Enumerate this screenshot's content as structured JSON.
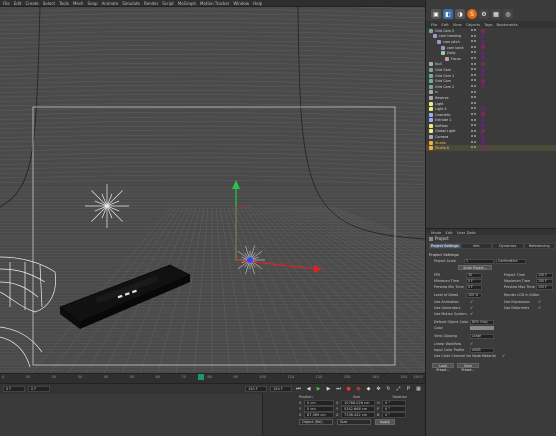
{
  "menubar": [
    "File",
    "Edit",
    "Create",
    "Select",
    "Tools",
    "Mesh",
    "Snap",
    "Animate",
    "Simulate",
    "Render",
    "Script",
    "MoGraph",
    "Motion Tracker",
    "Window",
    "Help"
  ],
  "viewport": {
    "name": "3D Perspective Viewport"
  },
  "timeline": {
    "ticks": [
      "0",
      "10",
      "20",
      "30",
      "40",
      "50",
      "60",
      "70",
      "80",
      "90",
      "100",
      "110",
      "120",
      "130",
      "140",
      "150"
    ],
    "end_frame": "150 F"
  },
  "transport": {
    "start_field": "0 F",
    "current_field": "0 F",
    "end_field": "150 F",
    "end2_field": "150 F"
  },
  "coords": {
    "headers": [
      "Position",
      "Size",
      "Rotation"
    ],
    "rows": [
      {
        "axis": "X",
        "pos": "0 cm",
        "size": "10768.026 cm",
        "rot_axis": "H",
        "rot": "0 °"
      },
      {
        "axis": "Y",
        "pos": "0 cm",
        "size": "5342.668 cm",
        "rot_axis": "P",
        "rot": "0 °"
      },
      {
        "axis": "Z",
        "pos": "87.569 cm",
        "size": "7338.442 cm",
        "rot_axis": "B",
        "rot": "0 °"
      }
    ],
    "mode": "Object (Rel)",
    "size_mode": "Size",
    "apply": "Apply"
  },
  "right_toolbar": {
    "icons": [
      "layout-icon",
      "cube-icon",
      "render-icon",
      "s-logo-icon",
      "gear-icon",
      "grid-icon",
      "target-icon"
    ]
  },
  "object_manager": {
    "menu": [
      "File",
      "Edit",
      "View",
      "Objects",
      "Tags",
      "Bookmarks"
    ],
    "objects": [
      {
        "name": "Grid Cam 2",
        "indent": 0
      },
      {
        "name": "cam heading",
        "indent": 1
      },
      {
        "name": "cam pitch",
        "indent": 2
      },
      {
        "name": "cam bank",
        "indent": 3
      },
      {
        "name": "Dolly",
        "indent": 3
      },
      {
        "name": "Focus",
        "indent": 4
      },
      {
        "name": "Null",
        "indent": 0
      },
      {
        "name": "Grid Cam",
        "indent": 0
      },
      {
        "name": "Grid Cam 1",
        "indent": 0
      },
      {
        "name": "Grid Cam",
        "indent": 0
      },
      {
        "name": "Grid Cam 2",
        "indent": 0
      },
      {
        "name": "sl",
        "indent": 0
      },
      {
        "name": "Reserve",
        "indent": 0
      },
      {
        "name": "Light",
        "indent": 0
      },
      {
        "name": "Light 4",
        "indent": 0
      },
      {
        "name": "Cosmetic",
        "indent": 0
      },
      {
        "name": "Extrude 1",
        "indent": 0
      },
      {
        "name": "Softbox",
        "indent": 0
      },
      {
        "name": "Global Light",
        "indent": 0
      },
      {
        "name": "Camera",
        "indent": 0
      },
      {
        "name": "Studio",
        "indent": 0
      },
      {
        "name": "Studio 6",
        "indent": 0
      }
    ]
  },
  "attribute_manager": {
    "menu": [
      "Mode",
      "Edit",
      "User Data"
    ],
    "title": "Project",
    "tabs": [
      "Project Settings",
      "Info",
      "Dynamics",
      "Referencing"
    ],
    "section": "Project Settings",
    "props_left": [
      {
        "label": "Project Scale",
        "value": "1"
      },
      {
        "label": "FPS",
        "value": "30"
      },
      {
        "label": "Minimum Time",
        "value": "0 F"
      },
      {
        "label": "Preview Min Time",
        "value": "0 F"
      },
      {
        "label": "Level of Detail",
        "value": "100 %"
      },
      {
        "label": "Use Animation",
        "value": "✓"
      },
      {
        "label": "Use Generators",
        "value": "✓"
      },
      {
        "label": "Use Motion System",
        "value": "✓"
      },
      {
        "label": "Default Object Color",
        "value": "80% Gray"
      },
      {
        "label": "Color",
        "value": ""
      },
      {
        "label": "View Clipping",
        "value": "Large"
      },
      {
        "label": "Linear Workflow",
        "value": "✓"
      },
      {
        "label": "Input Color Profile",
        "value": "sRGB"
      },
      {
        "label": "Use Color Channel for Node Material",
        "value": "✓"
      }
    ],
    "props_right": [
      {
        "label": "Project Time",
        "value": "150 F"
      },
      {
        "label": "Maximum Time",
        "value": "150 F"
      },
      {
        "label": "Preview Max Time",
        "value": "150 F"
      },
      {
        "label": "Render LOD in Editor",
        "value": ""
      },
      {
        "label": "Use Expression",
        "value": "✓"
      },
      {
        "label": "Use Deformers",
        "value": "✓"
      }
    ],
    "scale_unit": "Centimeters",
    "scale_button": "Scale Project...",
    "load_preset": "Load Preset...",
    "save_preset": "Save Preset..."
  }
}
